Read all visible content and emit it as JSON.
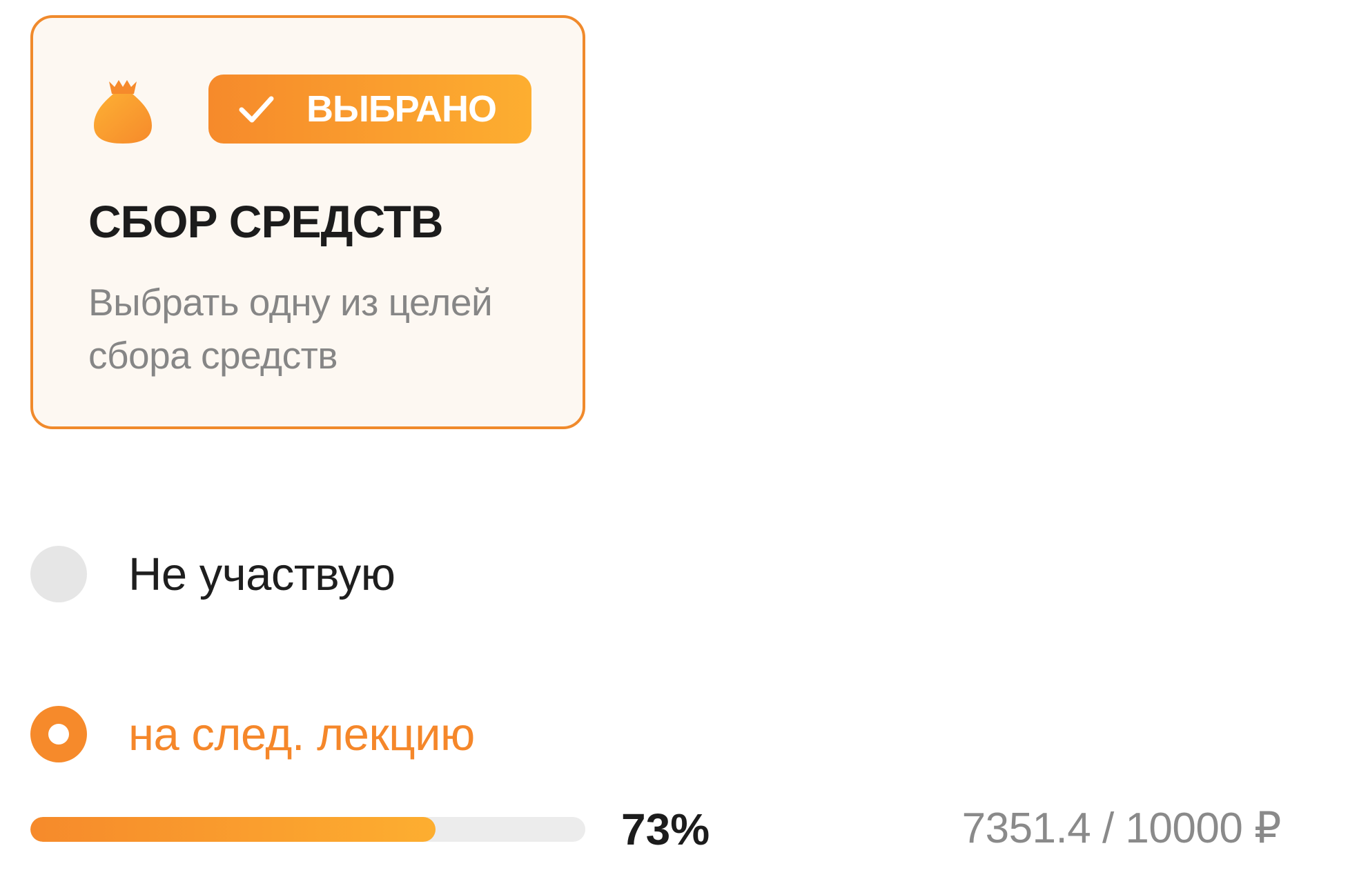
{
  "card": {
    "icon": "money-bag-icon",
    "badge": {
      "icon": "check-icon",
      "label": "ВЫБРАНО"
    },
    "title": "СБОР СРЕДСТВ",
    "description": "Выбрать одну из целей сбора средств"
  },
  "options": [
    {
      "label": "Не участвую",
      "selected": false
    },
    {
      "label": "на след. лекцию",
      "selected": true
    }
  ],
  "progress": {
    "percent_label": "73%",
    "fraction": 0.73,
    "amount_label": "7351.4 / 10000 ₽"
  },
  "colors": {
    "accent": "#f68a2b",
    "accent_light": "#fdae30",
    "card_background": "#fdf8f2",
    "title_text": "#1c1c1c",
    "muted_text": "#868686",
    "radio_unchecked": "#e6e6e6",
    "track": "#ececec"
  }
}
